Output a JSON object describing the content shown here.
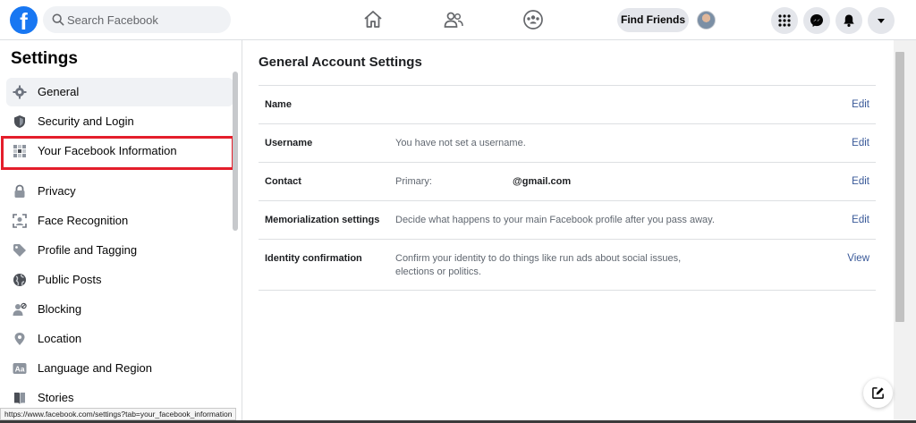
{
  "header": {
    "logo_letter": "f",
    "search_placeholder": "Search Facebook",
    "find_friends_label": "Find Friends",
    "nav_icons": [
      "home-icon",
      "friends-icon",
      "groups-icon"
    ],
    "action_icons": [
      "menu-grid-icon",
      "messenger-icon",
      "notifications-bell-icon",
      "account-caret-icon"
    ]
  },
  "sidebar": {
    "title": "Settings",
    "items": [
      {
        "label": "General",
        "icon": "gear-icon",
        "active": true
      },
      {
        "label": "Security and Login",
        "icon": "shield-icon"
      },
      {
        "label": "Your Facebook Information",
        "icon": "facebook-info-icon",
        "highlighted": true
      },
      {
        "label": "Privacy",
        "icon": "lock-icon"
      },
      {
        "label": "Face Recognition",
        "icon": "face-scan-icon"
      },
      {
        "label": "Profile and Tagging",
        "icon": "tag-icon"
      },
      {
        "label": "Public Posts",
        "icon": "globe-icon"
      },
      {
        "label": "Blocking",
        "icon": "block-user-icon"
      },
      {
        "label": "Location",
        "icon": "location-pin-icon"
      },
      {
        "label": "Language and Region",
        "icon": "language-icon"
      },
      {
        "label": "Stories",
        "icon": "book-icon"
      }
    ]
  },
  "main": {
    "title": "General Account Settings",
    "rows": [
      {
        "name": "Name",
        "value": "",
        "action": "Edit"
      },
      {
        "name": "Username",
        "value": "You have not set a username.",
        "action": "Edit"
      },
      {
        "name": "Contact",
        "value": "Primary:",
        "email": "@gmail.com",
        "action": "Edit"
      },
      {
        "name": "Memorialization settings",
        "value": "Decide what happens to your main Facebook profile after you pass away.",
        "action": "Edit"
      },
      {
        "name": "Identity confirmation",
        "value": "Confirm your identity to do things like run ads about social issues, elections or politics.",
        "action": "View"
      }
    ]
  },
  "status_bar": {
    "url": "https://www.facebook.com/settings?tab=your_facebook_information"
  },
  "colors": {
    "brand": "#1877f2",
    "link": "#385898",
    "highlight": "#e41e2b"
  }
}
